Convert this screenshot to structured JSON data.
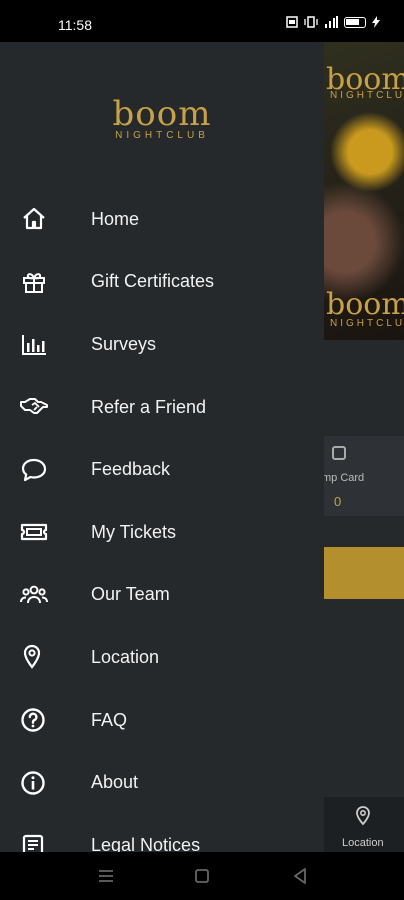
{
  "status_bar": {
    "time": "11:58"
  },
  "background_app": {
    "logo_text": "boom",
    "logo_subtext": "NIGHTCLUB",
    "stamp_card_label": "mp Card",
    "stamp_card_value": "0",
    "tab_location_label": "Location"
  },
  "drawer": {
    "logo_text": "boom",
    "logo_subtext": "NIGHTCLUB",
    "items": [
      {
        "label": "Home",
        "icon": "home-icon"
      },
      {
        "label": "Gift Certificates",
        "icon": "gift-icon"
      },
      {
        "label": "Surveys",
        "icon": "bar-chart-icon"
      },
      {
        "label": "Refer a Friend",
        "icon": "handshake-icon"
      },
      {
        "label": "Feedback",
        "icon": "chat-bubble-icon"
      },
      {
        "label": "My Tickets",
        "icon": "ticket-icon"
      },
      {
        "label": "Our Team",
        "icon": "team-icon"
      },
      {
        "label": "Location",
        "icon": "location-pin-icon"
      },
      {
        "label": "FAQ",
        "icon": "question-circle-icon"
      },
      {
        "label": "About",
        "icon": "info-circle-icon"
      },
      {
        "label": "Legal Notices",
        "icon": "document-icon"
      }
    ]
  },
  "colors": {
    "drawer_bg": "#25292c",
    "accent_gold": "#c8a046",
    "text": "#f2f2f2"
  }
}
